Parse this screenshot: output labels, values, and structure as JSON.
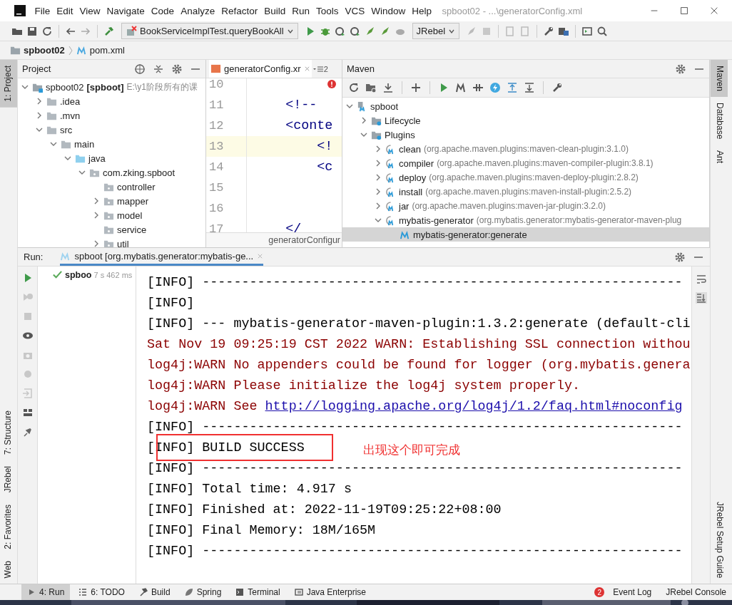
{
  "window": {
    "title": "spboot02 - ...\\generatorConfig.xml"
  },
  "menu": [
    "File",
    "Edit",
    "View",
    "Navigate",
    "Code",
    "Analyze",
    "Refactor",
    "Build",
    "Run",
    "Tools",
    "VCS",
    "Window",
    "Help"
  ],
  "toolbar": {
    "run_config": "BookServiceImplTest.queryBookAll",
    "jrebel": "JRebel"
  },
  "breadcrumb": [
    "spboot02",
    "pom.xml"
  ],
  "left_tabs": {
    "top": [
      {
        "label": "1: Project",
        "selected": true
      }
    ],
    "bottom": [
      {
        "label": "7: Structure",
        "selected": false
      },
      {
        "label": "JRebel",
        "selected": false
      },
      {
        "label": "2: Favorites",
        "selected": false
      },
      {
        "label": "Web",
        "selected": false
      }
    ]
  },
  "project": {
    "title": "Project",
    "tree": [
      {
        "label": "spboot02",
        "module": "[spboot]",
        "path": "E:\\y1阶段所有的课",
        "kind": "module",
        "expanded": true,
        "children": [
          {
            "label": ".idea",
            "kind": "folder",
            "expanded": false
          },
          {
            "label": ".mvn",
            "kind": "folder",
            "expanded": false
          },
          {
            "label": "src",
            "kind": "folder",
            "expanded": true,
            "children": [
              {
                "label": "main",
                "kind": "folder",
                "expanded": true,
                "children": [
                  {
                    "label": "java",
                    "kind": "source",
                    "expanded": true,
                    "children": [
                      {
                        "label": "com.zking.spboot",
                        "kind": "package",
                        "expanded": true,
                        "children": [
                          {
                            "label": "controller",
                            "kind": "package"
                          },
                          {
                            "label": "mapper",
                            "kind": "package",
                            "expanded": false
                          },
                          {
                            "label": "model",
                            "kind": "package",
                            "expanded": false
                          },
                          {
                            "label": "service",
                            "kind": "package"
                          },
                          {
                            "label": "util",
                            "kind": "package",
                            "expanded": false
                          }
                        ]
                      }
                    ]
                  }
                ]
              }
            ]
          }
        ]
      }
    ]
  },
  "editor": {
    "tab": "generatorConfig.xr",
    "more_tabs": "2",
    "footer": "generatorConfigur",
    "lines": [
      {
        "number": "10",
        "current": false
      },
      {
        "number": "11",
        "code": "    <!-- ",
        "current": false
      },
      {
        "number": "12",
        "code": "    <conte",
        "current": false
      },
      {
        "number": "13",
        "code": "        <!",
        "current": true
      },
      {
        "number": "14",
        "code": "        <c",
        "current": false
      },
      {
        "number": "15",
        "current": false
      },
      {
        "number": "16",
        "current": false
      },
      {
        "number": "17",
        "code": "    </",
        "current": false
      }
    ]
  },
  "maven": {
    "title": "Maven",
    "tree": [
      {
        "label": "spboot",
        "kind": "project",
        "expanded": true,
        "selected": false,
        "children": [
          {
            "label": "Lifecycle",
            "kind": "group",
            "expanded": false,
            "selected": false
          },
          {
            "label": "Plugins",
            "kind": "group",
            "expanded": true,
            "selected": false,
            "children": [
              {
                "label": "clean",
                "detail": "(org.apache.maven.plugins:maven-clean-plugin:3.1.0)",
                "kind": "plugin",
                "expanded": false,
                "selected": false
              },
              {
                "label": "compiler",
                "detail": "(org.apache.maven.plugins:maven-compiler-plugin:3.8.1)",
                "kind": "plugin",
                "expanded": false,
                "selected": false
              },
              {
                "label": "deploy",
                "detail": "(org.apache.maven.plugins:maven-deploy-plugin:2.8.2)",
                "kind": "plugin",
                "expanded": false,
                "selected": false
              },
              {
                "label": "install",
                "detail": "(org.apache.maven.plugins:maven-install-plugin:2.5.2)",
                "kind": "plugin",
                "expanded": false,
                "selected": false
              },
              {
                "label": "jar",
                "detail": "(org.apache.maven.plugins:maven-jar-plugin:3.2.0)",
                "kind": "plugin",
                "expanded": false,
                "selected": false
              },
              {
                "label": "mybatis-generator",
                "detail": "(org.mybatis.generator:mybatis-generator-maven-plug",
                "kind": "plugin",
                "expanded": true,
                "selected": false,
                "children": [
                  {
                    "label": "mybatis-generator:generate",
                    "kind": "goal",
                    "selected": true
                  }
                ]
              }
            ]
          }
        ]
      }
    ]
  },
  "right_tabs": {
    "top": [
      {
        "label": "Maven",
        "selected": true
      },
      {
        "label": "Database",
        "selected": false
      },
      {
        "label": "Ant",
        "selected": false
      }
    ],
    "bottom": [
      {
        "label": "JRebel Setup Guide",
        "selected": false
      }
    ]
  },
  "run": {
    "label": "Run:",
    "tab": "spboot [org.mybatis.generator:mybatis-ge...",
    "item": {
      "name": "spboo",
      "time": "7 s 462 ms"
    },
    "console": [
      {
        "kind": "info",
        "text": "[INFO] -------------------------------------------------------------"
      },
      {
        "kind": "info",
        "text": "[INFO]"
      },
      {
        "kind": "info",
        "text": "[INFO] --- mybatis-generator-maven-plugin:1.3.2:generate (default-cli"
      },
      {
        "kind": "warn",
        "text": "Sat Nov 19 09:25:19 CST 2022 WARN: Establishing SSL connection withou"
      },
      {
        "kind": "warn",
        "text": "log4j:WARN No appenders could be found for logger (org.mybatis.genera"
      },
      {
        "kind": "warn",
        "text": "log4j:WARN Please initialize the log4j system properly."
      },
      {
        "kind": "warn",
        "text": "log4j:WARN See ",
        "link": "http://logging.apache.org/log4j/1.2/faq.html#noconfig"
      },
      {
        "kind": "info",
        "text": "[INFO] -------------------------------------------------------------"
      },
      {
        "kind": "info",
        "text": "[INFO] BUILD SUCCESS"
      },
      {
        "kind": "info",
        "text": "[INFO] -------------------------------------------------------------"
      },
      {
        "kind": "info",
        "text": "[INFO] Total time: 4.917 s"
      },
      {
        "kind": "info",
        "text": "[INFO] Finished at: 2022-11-19T09:25:22+08:00"
      },
      {
        "kind": "info",
        "text": "[INFO] Final Memory: 18M/165M"
      },
      {
        "kind": "info",
        "text": "[INFO] -------------------------------------------------------------"
      }
    ],
    "annotation": "出现这个即可完成"
  },
  "bottom_tabs": [
    {
      "label": "4: Run",
      "selected": true,
      "kind": "run"
    },
    {
      "label": "6: TODO",
      "selected": false,
      "kind": "todo"
    },
    {
      "label": "Build",
      "selected": false,
      "kind": "build"
    },
    {
      "label": "Spring",
      "selected": false,
      "kind": "spring"
    },
    {
      "label": "Terminal",
      "selected": false,
      "kind": "terminal"
    },
    {
      "label": "Java Enterprise",
      "selected": false,
      "kind": "enterprise"
    }
  ],
  "status": {
    "event_log": "Event Log",
    "event_count": "2",
    "jrebel_console": "JRebel Console"
  }
}
